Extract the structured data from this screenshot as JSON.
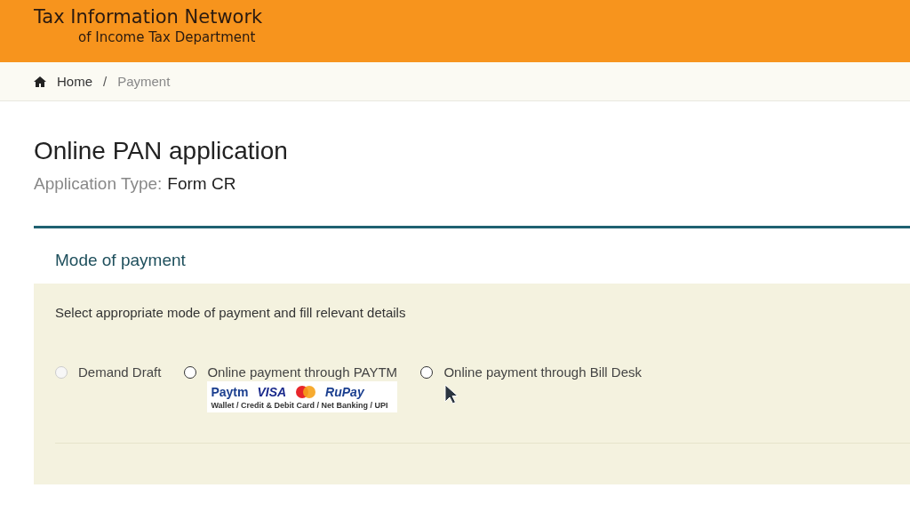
{
  "header": {
    "title": "Tax Information Network",
    "subtitle": "of Income Tax Department"
  },
  "breadcrumb_separator": "/",
  "breadcrumb": [
    {
      "label": "Home",
      "kind": "home"
    },
    {
      "label": "Payment",
      "kind": "current"
    }
  ],
  "page": {
    "title": "Online PAN application",
    "type_label": "Application Type:",
    "type_value": "Form CR"
  },
  "section": {
    "title": "Mode of payment",
    "instruction": "Select appropriate mode of payment and fill relevant details",
    "options": [
      {
        "label": "Demand Draft",
        "selected": false,
        "disabled": true
      },
      {
        "label": "Online payment through PAYTM",
        "selected": false,
        "disabled": false,
        "badge": {
          "logos": [
            "Paytm",
            "VISA",
            "RuPay"
          ],
          "caption": "Wallet / Credit & Debit Card / Net Banking / UPI"
        }
      },
      {
        "label": "Online payment through Bill Desk",
        "selected": false,
        "disabled": false
      }
    ]
  }
}
